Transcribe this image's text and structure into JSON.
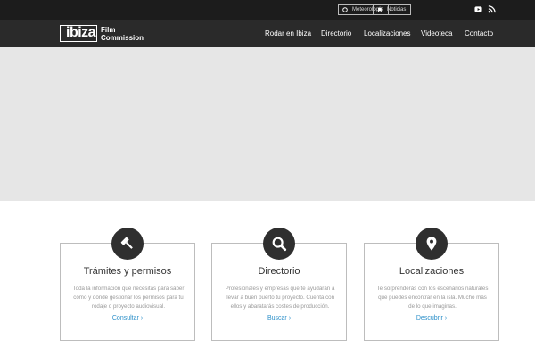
{
  "topbar": {
    "links": [
      {
        "label": "Meteorología",
        "icon": "circle-icon"
      },
      {
        "label": "Noticias",
        "icon": "bookmark-icon"
      }
    ],
    "social": [
      "youtube-icon",
      "rss-icon"
    ]
  },
  "logo": {
    "main": "ibiza",
    "line1": "Film",
    "line2": "Commission"
  },
  "nav": [
    "Rodar en Ibiza",
    "Directorio",
    "Localizaciones",
    "Videoteca",
    "Contacto"
  ],
  "cards": [
    {
      "icon": "gavel-icon",
      "title": "Trámites y permisos",
      "text": "Toda la información que necesitas para saber cómo y dónde gestionar los permisos para tu rodaje o proyecto audiovisual.",
      "link": "Consultar ›"
    },
    {
      "icon": "search-icon",
      "title": "Directorio",
      "text": "Profesionales y empresas que te ayudarán a llevar a buen puerto tu proyecto. Cuenta con ellos y abaratarás costes de producción.",
      "link": "Buscar ›"
    },
    {
      "icon": "map-pin-icon",
      "title": "Localizaciones",
      "text": "Te sorprenderás con los escenarios naturales que puedes encontrar en la isla. Mucho más de lo que imaginas.",
      "link": "Descubrir ›"
    }
  ],
  "colors": {
    "topbar": "#1c1c1c",
    "navbar": "#2a2a2a",
    "hero": "#e6e6e6",
    "link": "#2b8fc9",
    "icon_bg": "#2f2f2f"
  }
}
